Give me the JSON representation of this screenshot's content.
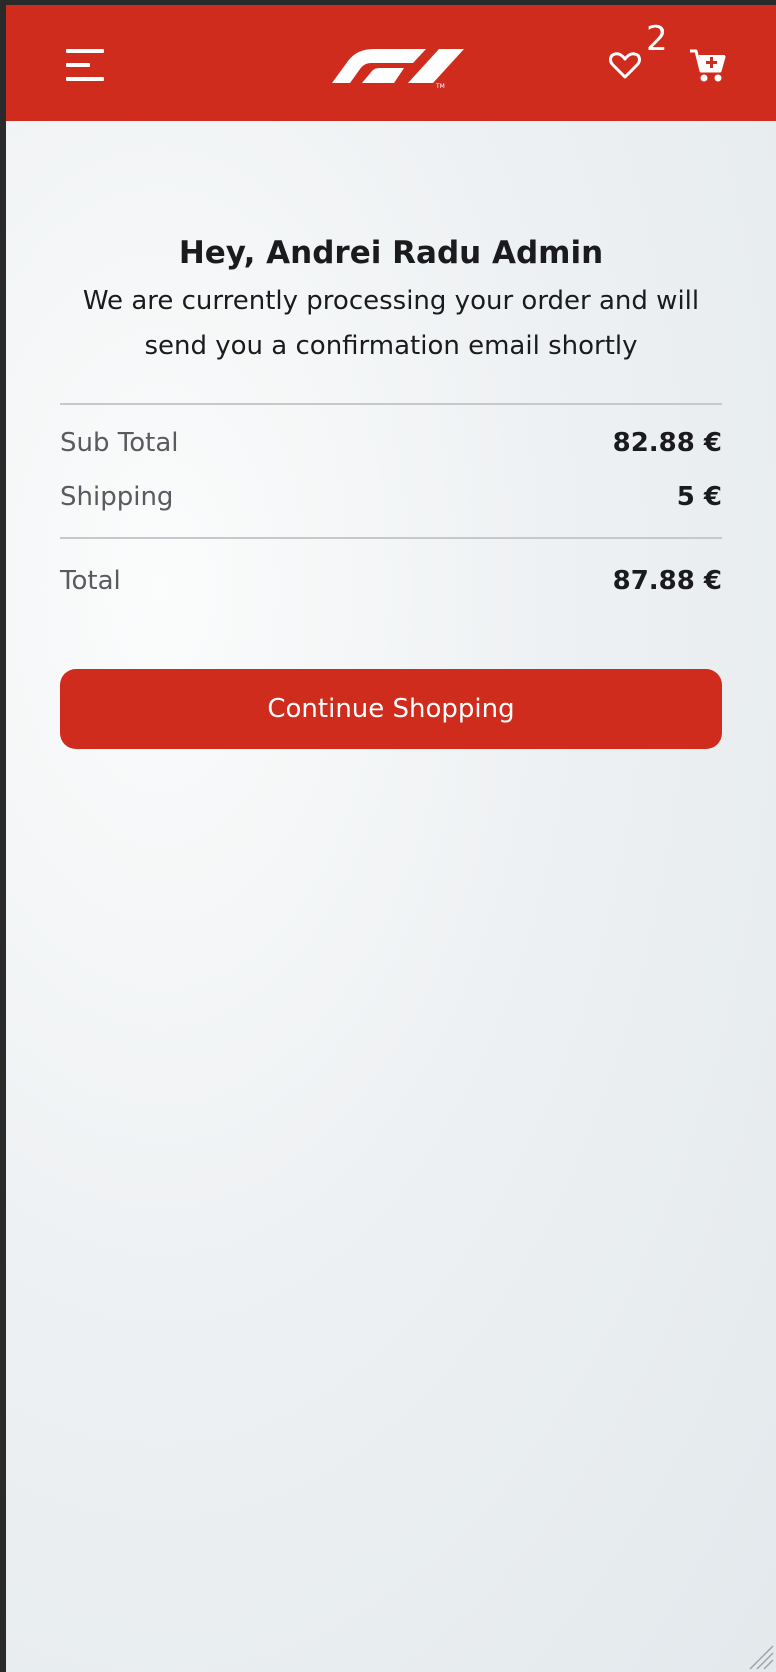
{
  "header": {
    "menu_icon": "hamburger-menu-icon",
    "logo": "f1-logo",
    "wishlist_icon": "heart-icon",
    "wishlist_count": "2",
    "cart_icon": "cart-plus-icon",
    "brand_color": "#cf2c1e"
  },
  "confirmation": {
    "greeting": "Hey, Andrei Radu Admin",
    "message": "We are currently processing your order and will send you a confirmation email shortly"
  },
  "summary": {
    "subtotal_label": "Sub Total",
    "subtotal_value": "82.88 €",
    "shipping_label": "Shipping",
    "shipping_value": "5 €",
    "total_label": "Total",
    "total_value": "87.88 €"
  },
  "actions": {
    "continue_label": "Continue Shopping"
  }
}
